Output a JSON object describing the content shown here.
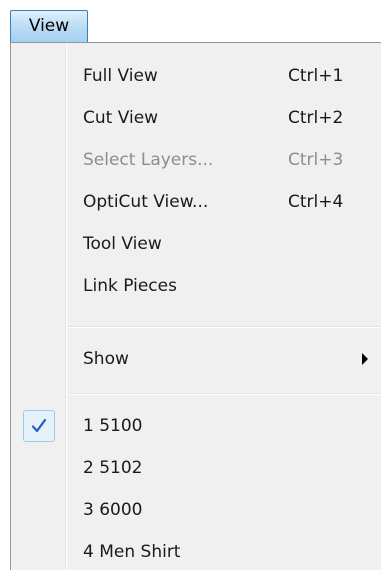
{
  "menubar": {
    "view_label": "View"
  },
  "menu": {
    "items": [
      {
        "label": "Full View",
        "shortcut": "Ctrl+1",
        "enabled": true
      },
      {
        "label": "Cut View",
        "shortcut": "Ctrl+2",
        "enabled": true
      },
      {
        "label": "Select Layers...",
        "shortcut": "Ctrl+3",
        "enabled": false
      },
      {
        "label": "OptiCut View...",
        "shortcut": "Ctrl+4",
        "enabled": true
      },
      {
        "label": "Tool View",
        "shortcut": "",
        "enabled": true
      },
      {
        "label": "Link Pieces",
        "shortcut": "",
        "enabled": true
      }
    ],
    "show": {
      "label": "Show",
      "icon": "submenu-arrow-icon"
    },
    "recent": [
      {
        "label": "1 5100",
        "checked": true
      },
      {
        "label": "2 5102",
        "checked": false
      },
      {
        "label": "3 6000",
        "checked": false
      },
      {
        "label": "4 Men Shirt",
        "checked": false
      }
    ]
  },
  "colors": {
    "check_mark": "#1f5fbf",
    "disabled_text": "#8d8d8d",
    "menu_background": "#f0f0f0",
    "tab_border": "#3c7fb1"
  }
}
